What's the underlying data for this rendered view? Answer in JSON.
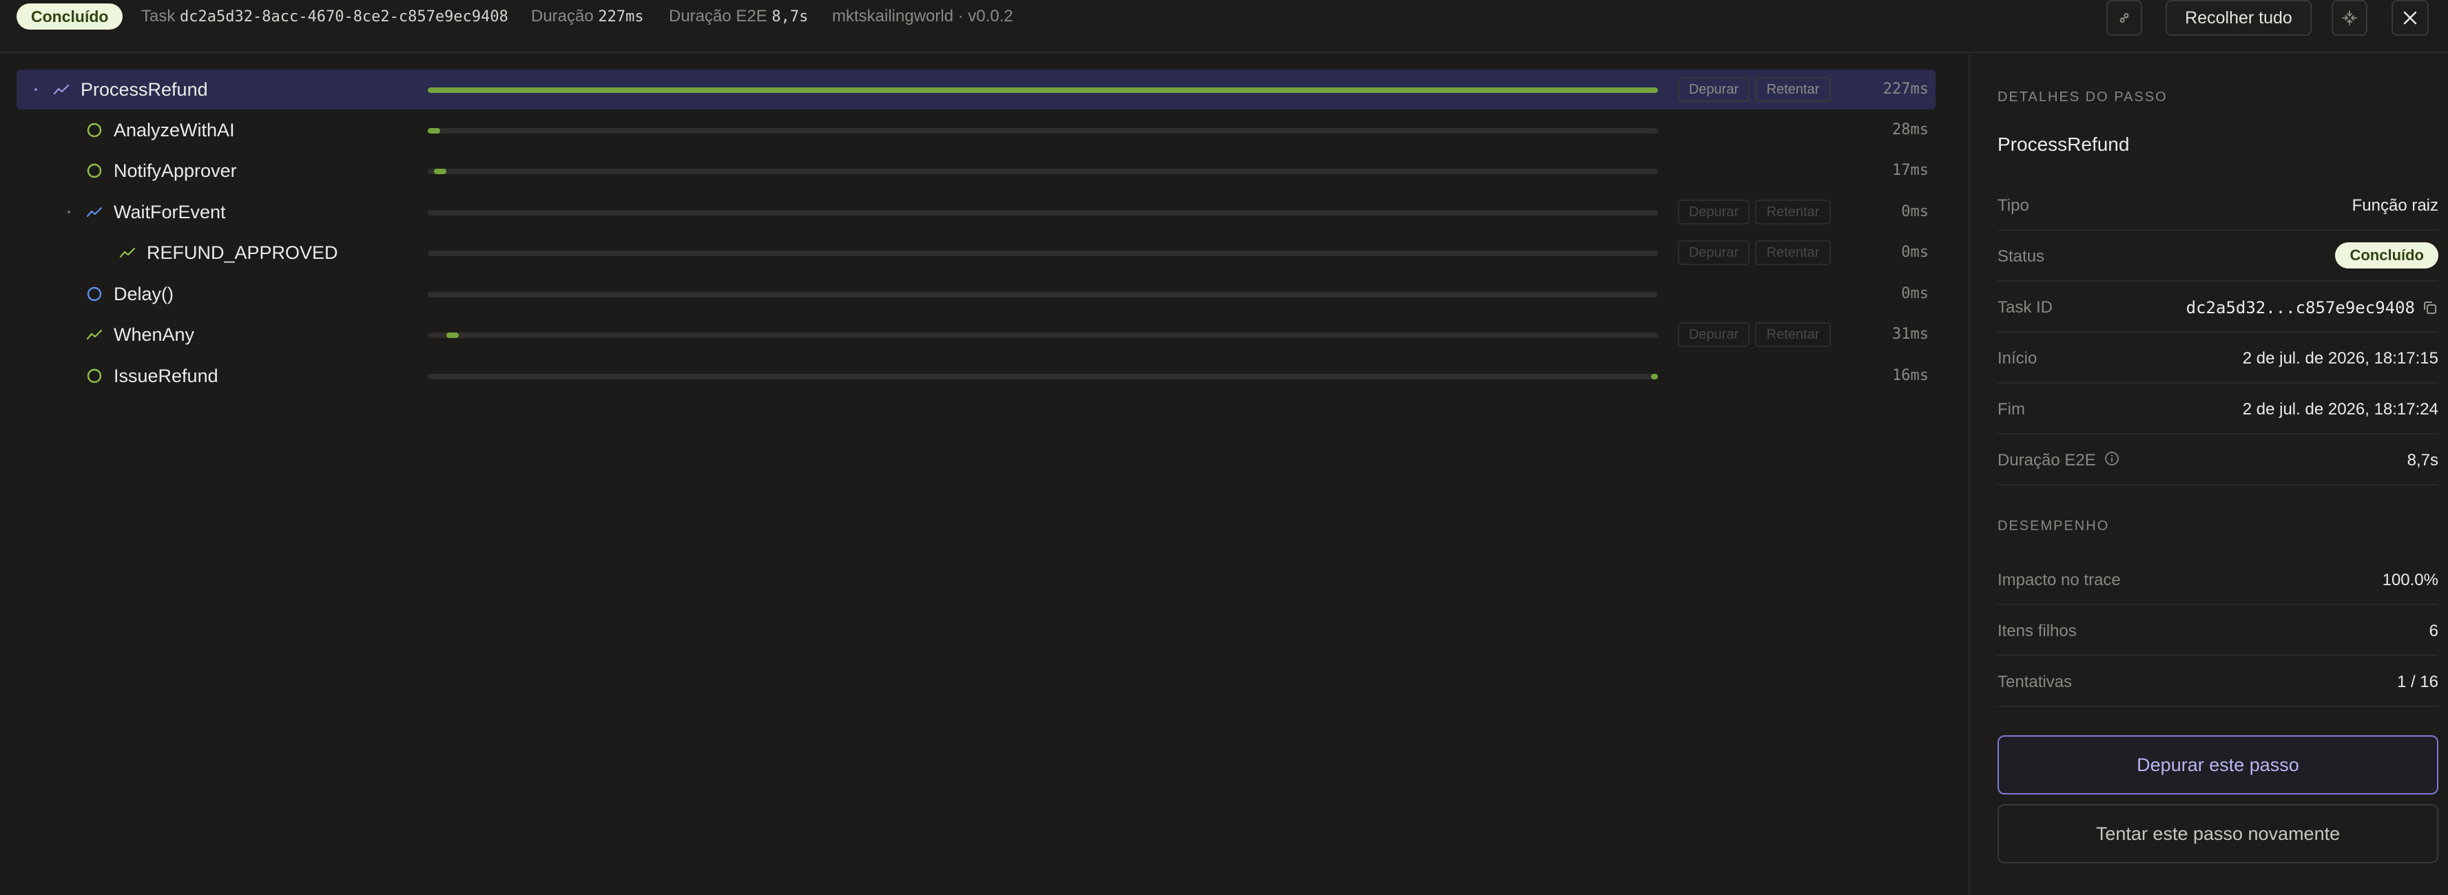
{
  "header": {
    "status": "Concluído",
    "task_label": "Task",
    "task_id": "dc2a5d32-8acc-4670-8ce2-c857e9ec9408",
    "duration_label": "Duração",
    "duration_value": "227ms",
    "e2e_label": "Duração E2E",
    "e2e_value": "8,7s",
    "app": "mktskailingworld · v0.0.2",
    "collapse_label": "Recolher tudo",
    "link_icon": "link-icon",
    "expand_icon": "expand-icon",
    "close_icon": "close-icon"
  },
  "colors": {
    "accent": "#7d7ad6",
    "success_fill": "#75a43a",
    "badge_bg": "#edf5dc",
    "selected_row": "#2a2b4f"
  },
  "tree": {
    "debug_label": "Depurar",
    "retry_label": "Retentar",
    "rows": [
      {
        "name": "ProcessRefund",
        "icon": "trend-icon",
        "duration": "227ms",
        "progress_start": 0.0,
        "progress_end": 1.0,
        "selected": true
      },
      {
        "name": "AnalyzeWithAI",
        "icon": "circle-icon",
        "duration": "28ms",
        "progress_start": 0.0,
        "progress_end": 0.01
      },
      {
        "name": "NotifyApprover",
        "icon": "circle-icon",
        "duration": "17ms",
        "progress_start": 0.005,
        "progress_end": 0.015
      },
      {
        "name": "WaitForEvent",
        "icon": "trend-icon",
        "duration": "0ms",
        "progress_start": 0.0,
        "progress_end": 0.0
      },
      {
        "name": "REFUND_APPROVED",
        "icon": "trend-icon",
        "duration": "0ms",
        "progress_start": 0.0,
        "progress_end": 0.0
      },
      {
        "name": "Delay()",
        "icon": "circle-icon",
        "duration": "0ms",
        "progress_start": 0.0,
        "progress_end": 0.0
      },
      {
        "name": "WhenAny",
        "icon": "trend-icon",
        "duration": "31ms",
        "progress_start": 0.015,
        "progress_end": 0.025
      },
      {
        "name": "IssueRefund",
        "icon": "circle-icon",
        "duration": "16ms",
        "progress_start": 0.995,
        "progress_end": 1.0
      }
    ]
  },
  "details": {
    "section_title": "DETALHES DO PASSO",
    "step_name": "ProcessRefund",
    "rows": [
      {
        "label": "Tipo",
        "value": "Função raiz"
      },
      {
        "label": "Status",
        "value": "Concluído"
      },
      {
        "label": "Task ID",
        "value": "dc2a5d32...c857e9ec9408"
      },
      {
        "label": "Início",
        "value": "2 de jul. de 2026, 18:17:15"
      },
      {
        "label": "Fim",
        "value": "2 de jul. de 2026, 18:17:24"
      },
      {
        "label": "Duração E2E",
        "value": "8,7s"
      }
    ],
    "performance_title": "DESEMPENHO",
    "performance": [
      {
        "label": "Impacto no trace",
        "value": "100.0%"
      },
      {
        "label": "Itens filhos",
        "value": "6"
      },
      {
        "label": "Tentativas",
        "value": "1 / 16"
      }
    ],
    "debug_step_label": "Depurar este passo",
    "retry_step_label": "Tentar este passo novamente"
  }
}
